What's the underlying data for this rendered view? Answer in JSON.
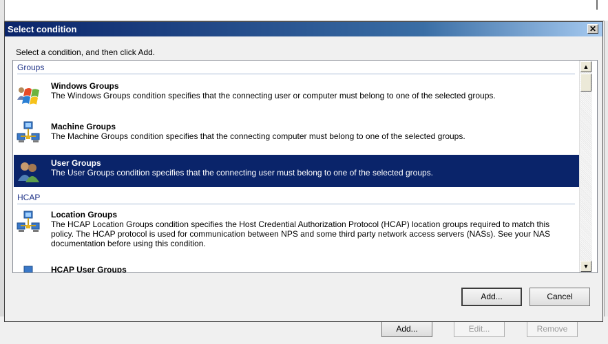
{
  "dialog": {
    "title": "Select condition",
    "close_glyph": "✕",
    "instruction": "Select a condition, and then click Add.",
    "add_label": "Add...",
    "cancel_label": "Cancel"
  },
  "list": {
    "groups": [
      {
        "header": "Groups",
        "items": [
          {
            "title": "Windows Groups",
            "description": "The Windows Groups condition specifies that the connecting user or computer must belong to one of the selected groups.",
            "icon": "windows-groups-icon"
          },
          {
            "title": "Machine Groups",
            "description": "The Machine Groups condition specifies that the connecting computer must belong to one of the selected groups.",
            "icon": "network-computers-icon"
          },
          {
            "title": "User Groups",
            "description": "The User Groups condition specifies that the connecting user must belong to one of the selected groups.",
            "icon": "users-icon",
            "selected": true
          }
        ]
      },
      {
        "header": "HCAP",
        "items": [
          {
            "title": "Location Groups",
            "description": "The HCAP Location Groups condition specifies the Host Credential Authorization Protocol (HCAP) location groups required to match this policy. The HCAP protocol is used for communication between NPS and some third party network access servers (NASs). See your NAS documentation before using this condition.",
            "icon": "network-computers-icon"
          },
          {
            "title": "HCAP User Groups",
            "description": "",
            "icon": "network-computers-icon"
          }
        ]
      }
    ],
    "scroll_up_glyph": "▲",
    "scroll_down_glyph": "▼"
  },
  "background": {
    "add_label": "Add...",
    "edit_label": "Edit...",
    "remove_label": "Remove"
  },
  "colors": {
    "selection": "#0a246a",
    "title_gradient_start": "#0a246a",
    "group_header_text": "#1e3287"
  }
}
